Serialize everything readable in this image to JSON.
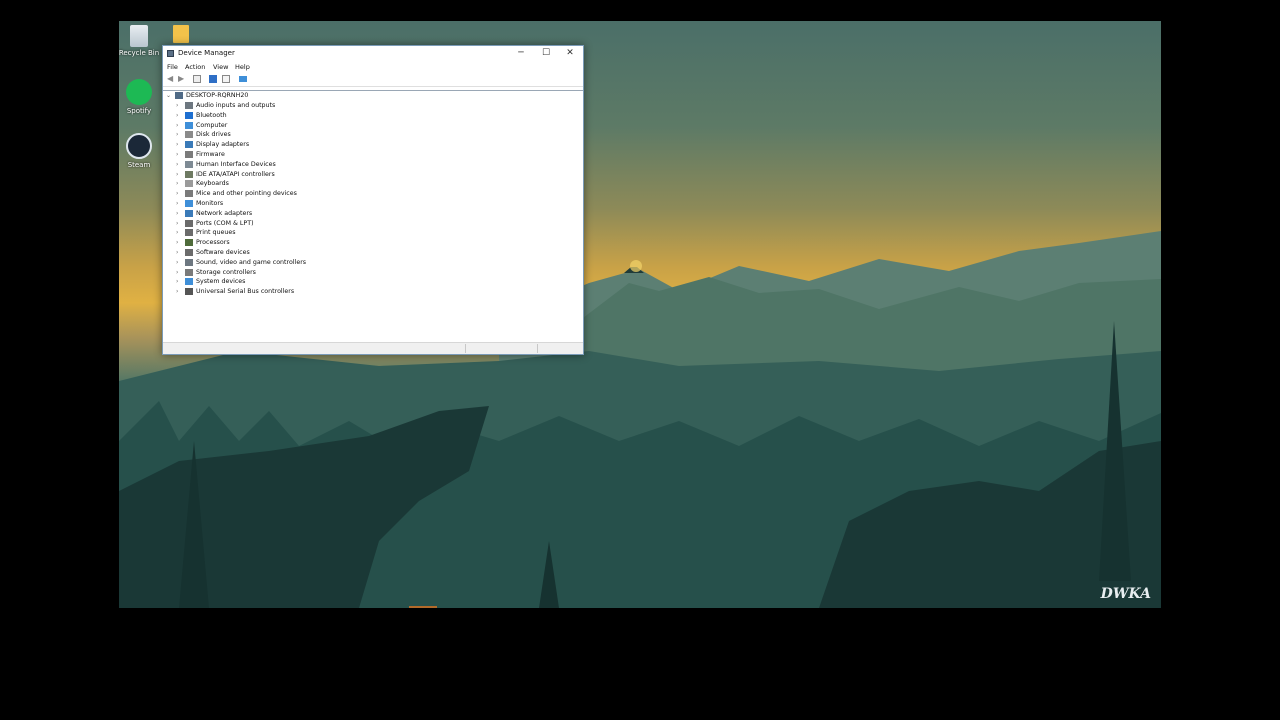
{
  "desktop": {
    "icons": [
      {
        "name": "recycle-bin",
        "label": "Recycle Bin",
        "icon": "recycle-bin-icon"
      },
      {
        "name": "folder",
        "label": "",
        "icon": "folder-icon"
      },
      {
        "name": "spotify",
        "label": "Spotify",
        "icon": "spotify-icon"
      },
      {
        "name": "steam",
        "label": "Steam",
        "icon": "steam-icon"
      }
    ],
    "watermark": "DWKA"
  },
  "window": {
    "title": "Device Manager",
    "controls": {
      "minimize": "─",
      "maximize": "☐",
      "close": "✕"
    },
    "menu": [
      "File",
      "Action",
      "View",
      "Help"
    ],
    "toolbar": [
      "back-icon",
      "forward-icon",
      "properties-icon",
      "help-icon",
      "view-icon",
      "monitor-icon"
    ],
    "root": "DESKTOP-RQRNH20",
    "categories": [
      {
        "label": "Audio inputs and outputs",
        "icon": "speaker-icon",
        "color": "#6d7780"
      },
      {
        "label": "Bluetooth",
        "icon": "bluetooth-icon",
        "color": "#1e6fd0"
      },
      {
        "label": "Computer",
        "icon": "computer-icon",
        "color": "#3f8fd8"
      },
      {
        "label": "Disk drives",
        "icon": "disk-icon",
        "color": "#8a8a8a"
      },
      {
        "label": "Display adapters",
        "icon": "display-adapter-icon",
        "color": "#3a7ab8"
      },
      {
        "label": "Firmware",
        "icon": "firmware-icon",
        "color": "#7b7b7b"
      },
      {
        "label": "Human Interface Devices",
        "icon": "hid-icon",
        "color": "#7e8a94"
      },
      {
        "label": "IDE ATA/ATAPI controllers",
        "icon": "ide-icon",
        "color": "#6e7a62"
      },
      {
        "label": "Keyboards",
        "icon": "keyboard-icon",
        "color": "#9a9a9a"
      },
      {
        "label": "Mice and other pointing devices",
        "icon": "mouse-icon",
        "color": "#7a7a7a"
      },
      {
        "label": "Monitors",
        "icon": "monitor-icon",
        "color": "#3f8fd8"
      },
      {
        "label": "Network adapters",
        "icon": "network-icon",
        "color": "#3a7ab8"
      },
      {
        "label": "Ports (COM & LPT)",
        "icon": "port-icon",
        "color": "#6b6b6b"
      },
      {
        "label": "Print queues",
        "icon": "printer-icon",
        "color": "#6b6b6b"
      },
      {
        "label": "Processors",
        "icon": "processor-icon",
        "color": "#4f6b3a"
      },
      {
        "label": "Software devices",
        "icon": "software-icon",
        "color": "#6b6b6b"
      },
      {
        "label": "Sound, video and game controllers",
        "icon": "sound-icon",
        "color": "#6d7780"
      },
      {
        "label": "Storage controllers",
        "icon": "storage-icon",
        "color": "#7a7a7a"
      },
      {
        "label": "System devices",
        "icon": "system-icon",
        "color": "#3f8fd8"
      },
      {
        "label": "Universal Serial Bus controllers",
        "icon": "usb-icon",
        "color": "#555555"
      }
    ]
  }
}
